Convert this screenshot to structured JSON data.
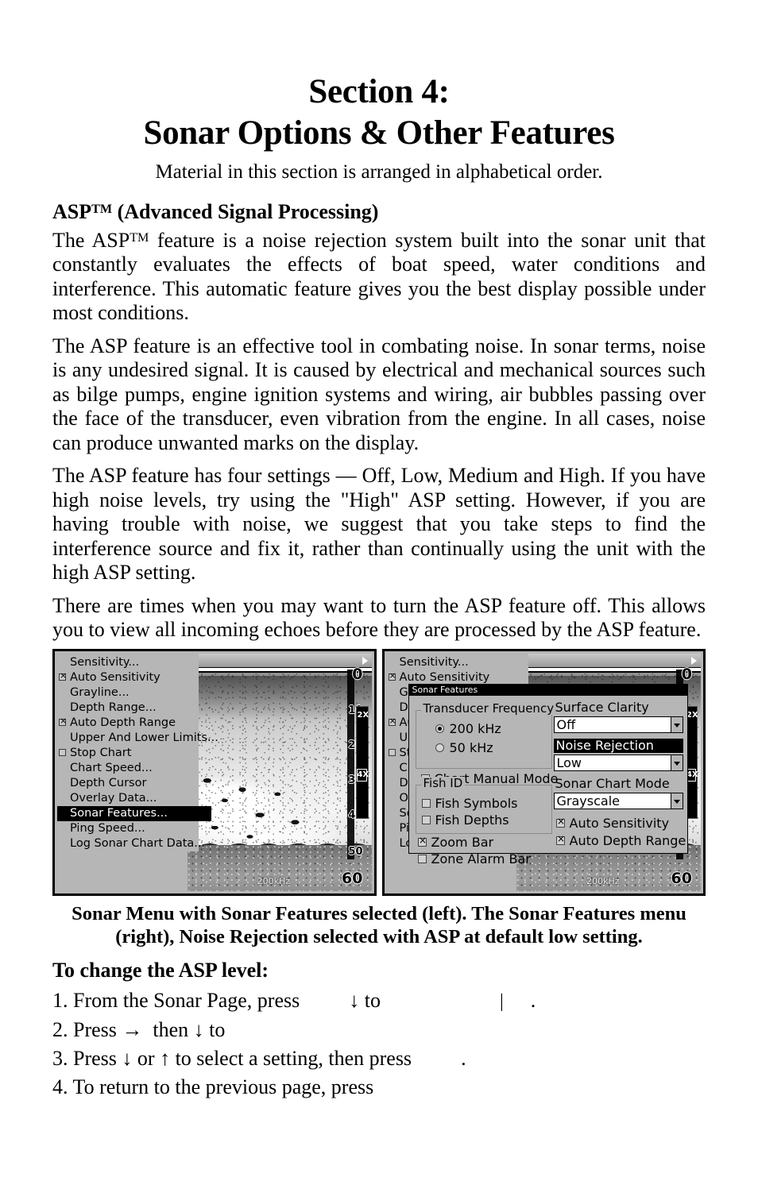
{
  "heading": {
    "line1": "Section 4:",
    "line2": "Sonar Options & Other Features",
    "subtitle": "Material in this section is arranged in alphabetical order."
  },
  "topic_heading": {
    "prefix": "ASP",
    "tm": "TM",
    "suffix": " (Advanced Signal Processing)"
  },
  "paragraphs": {
    "p1_part1": "The ASP",
    "p1_tm": "TM",
    "p1_part2": " feature is a noise rejection system built into the sonar unit that constantly evaluates the effects of boat speed, water conditions and interference. This automatic feature gives you the best display possible under most conditions.",
    "p2": "The ASP feature is an effective tool in combating noise. In sonar terms, noise is any undesired signal. It is caused by electrical and mechanical sources such as bilge pumps, engine ignition systems and wiring, air bubbles passing over the face of the transducer, even vibration from the engine. In all cases, noise can produce unwanted marks on the display.",
    "p3": "The ASP feature has four settings — Off, Low, Medium and High. If you have high noise levels, try using the \"High\" ASP setting. However, if you are having trouble with noise, we suggest that you take steps to find the interference source and fix it, rather than continually using the unit with the high ASP setting.",
    "p4": "There are times when you may want to turn the ASP feature off. This allows you to view all incoming echoes before they are processed by the ASP feature."
  },
  "figure": {
    "caption_line1": "Sonar Menu with Sonar Features selected (left). The Sonar Features",
    "caption_line2": "menu (right), Noise Rejection selected with ASP at default low setting.",
    "sonar_menu": {
      "items": [
        {
          "label": "Sensitivity...",
          "checkbox": "none",
          "selected": false
        },
        {
          "label": "Auto Sensitivity",
          "checkbox": "checked",
          "selected": false
        },
        {
          "label": "Grayline...",
          "checkbox": "none",
          "selected": false
        },
        {
          "label": "Depth Range...",
          "checkbox": "none",
          "selected": false
        },
        {
          "label": "Auto Depth Range",
          "checkbox": "checked",
          "selected": false
        },
        {
          "label": "Upper And Lower Limits...",
          "checkbox": "none",
          "selected": false
        },
        {
          "label": "Stop Chart",
          "checkbox": "unchecked",
          "selected": false
        },
        {
          "label": "Chart Speed...",
          "checkbox": "none",
          "selected": false
        },
        {
          "label": "Depth Cursor",
          "checkbox": "none",
          "selected": false
        },
        {
          "label": "Overlay Data...",
          "checkbox": "none",
          "selected": false
        },
        {
          "label": "Sonar Features...",
          "checkbox": "none",
          "selected": true
        },
        {
          "label": "Ping Speed...",
          "checkbox": "none",
          "selected": false
        },
        {
          "label": "Log Sonar Chart Data...",
          "checkbox": "none",
          "selected": false
        }
      ]
    },
    "chart": {
      "depth_labels": [
        "0",
        "10",
        "20",
        "30",
        "40",
        "50",
        "60"
      ],
      "zoom_2x": "2X",
      "zoom_4x": "4X",
      "frequency_label": "200kHz"
    },
    "dialog": {
      "title": "Sonar Features",
      "transducer_group": "Transducer Frequency",
      "freq_options": [
        {
          "label": "200 kHz",
          "selected": true
        },
        {
          "label": "50 kHz",
          "selected": false
        }
      ],
      "chart_manual_mode": {
        "label": "Chart Manual Mode",
        "checked": false
      },
      "fish_id_group": "Fish ID",
      "fish_symbols": {
        "label": "Fish Symbols",
        "checked": false
      },
      "fish_depths": {
        "label": "Fish Depths",
        "checked": false
      },
      "zoom_bar": {
        "label": "Zoom Bar",
        "checked": true
      },
      "zone_alarm_bar": {
        "label": "Zone Alarm Bar",
        "checked": false
      },
      "surface_clarity_label": "Surface Clarity",
      "surface_clarity_value": "Off",
      "noise_rejection_label": "Noise Rejection",
      "noise_rejection_value": "Low",
      "sonar_chart_mode_label": "Sonar Chart Mode",
      "sonar_chart_mode_value": "Grayscale",
      "auto_sensitivity": {
        "label": "Auto Sensitivity",
        "checked": true
      },
      "auto_depth_range": {
        "label": "Auto Depth Range",
        "checked": true
      }
    }
  },
  "instructions": {
    "heading": "To change the ASP level:",
    "step1_a": "1. From the Sonar Page, press",
    "step1_arrow": "↓",
    "step1_b": "to",
    "step1_bar": "|",
    "step1_end": ".",
    "step2_a": "2. Press",
    "step2_arrow1": "→",
    "step2_b": "then",
    "step2_arrow2": "↓",
    "step2_c": "to",
    "step3_a": "3. Press",
    "step3_arrow1": "↓",
    "step3_b": "or",
    "step3_arrow2": "↑",
    "step3_c": "to select a setting, then press",
    "step3_end": ".",
    "step4": "4. To return to the previous page, press"
  }
}
